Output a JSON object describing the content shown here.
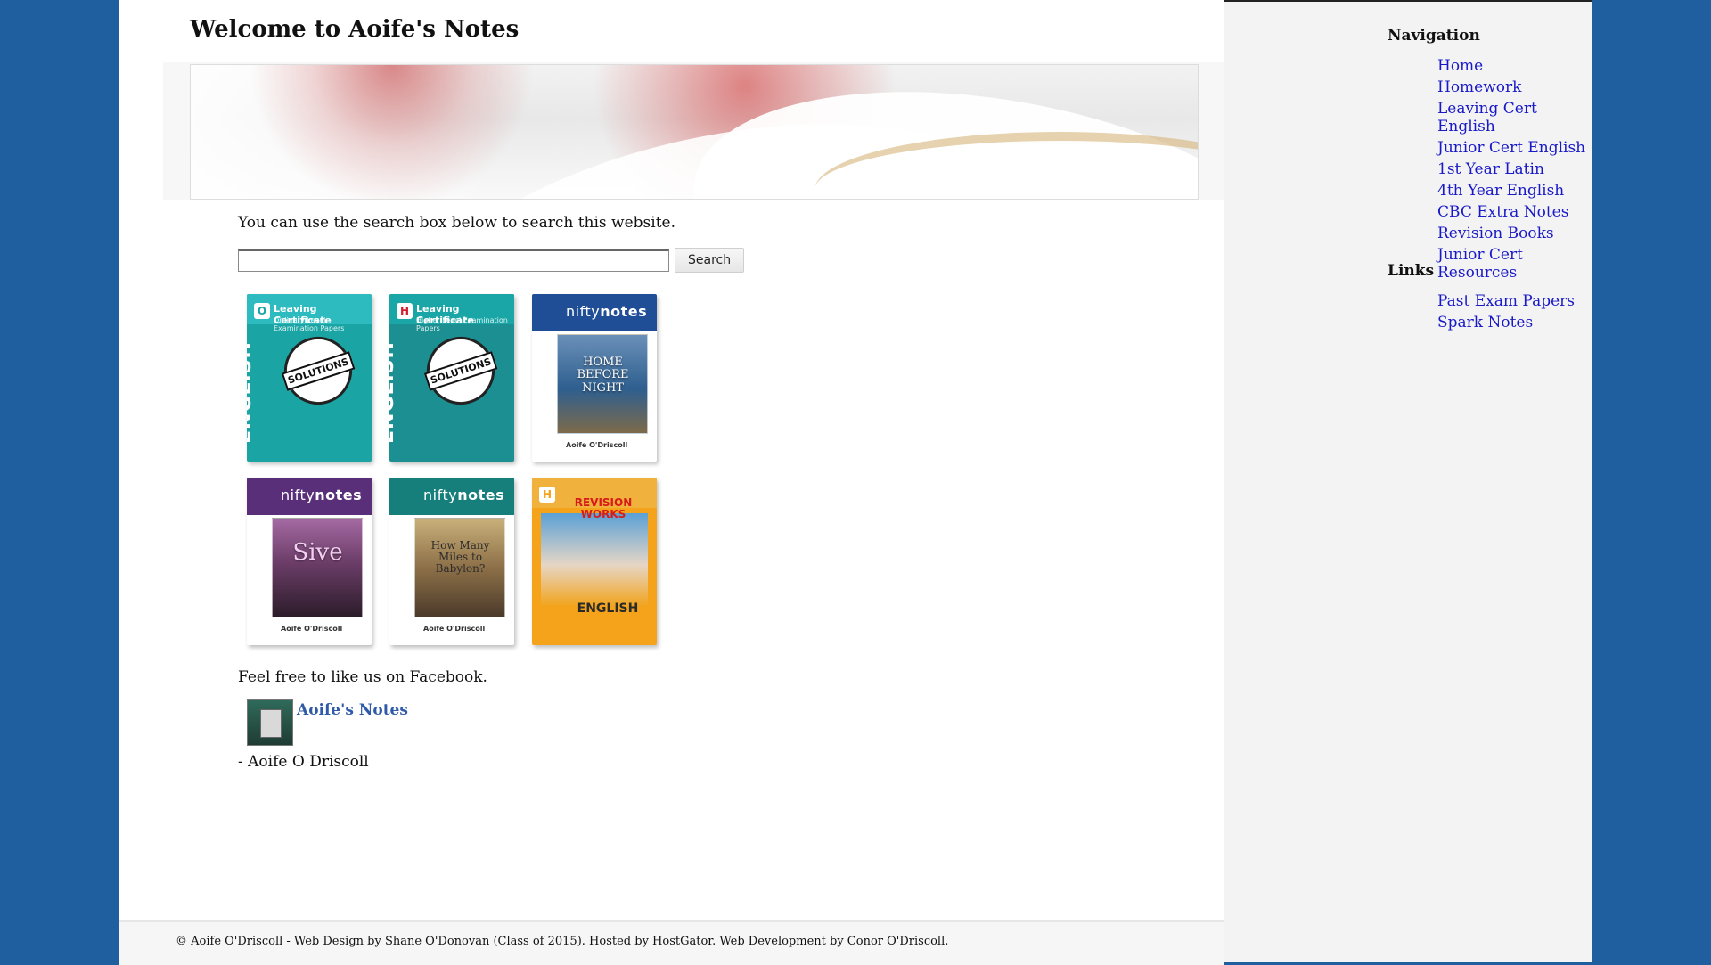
{
  "site": {
    "title": "Welcome to Aoife's Notes"
  },
  "main": {
    "intro": "You can use the search box below to search this website.",
    "search": {
      "value": "",
      "placeholder": "",
      "button_label": "Search"
    },
    "books": [
      {
        "color": "#1aa5a4",
        "level_badge": "O",
        "subject": "ENGLISH",
        "series": "Leaving Certificate",
        "subtitle": "Ordinary Level Examination Papers",
        "seal": "SOLUTIONS"
      },
      {
        "color": "#1b8f91",
        "level_badge": "H",
        "subject": "ENGLISH",
        "series": "Leaving Certificate",
        "subtitle": "Higher Level Examination Papers",
        "seal": "SOLUTIONS"
      },
      {
        "color": "#1f4e96",
        "brand": "nifty",
        "brand_bold": "notes",
        "title": "HOME BEFORE NIGHT",
        "author": "Aoife O'Driscoll"
      },
      {
        "color": "#5a2f7a",
        "brand": "nifty",
        "brand_bold": "notes",
        "title": "Sive",
        "author": "Aoife O'Driscoll"
      },
      {
        "color": "#167e7b",
        "brand": "nifty",
        "brand_bold": "notes",
        "title": "How Many Miles to Babylon?",
        "author": "Aoife O'Driscoll"
      },
      {
        "color": "#f4a31a",
        "level_badge": "H",
        "title": "REVISION WORKS",
        "subject": "ENGLISH"
      }
    ],
    "facebook_text": "Feel free to like us on Facebook.",
    "facebook_link": "Aoife's Notes",
    "signature": "- Aoife O Driscoll"
  },
  "footer": {
    "text": "© Aoife O'Driscoll - Web Design by Shane O'Donovan (Class of 2015). Hosted by HostGator. Web Development by Conor O'Driscoll."
  },
  "sidebar": {
    "navigation_title": "Navigation",
    "navigation_items": [
      "Home",
      "Homework",
      "Leaving Cert English",
      "Junior Cert English",
      "1st Year Latin",
      "4th Year English",
      "CBC Extra Notes",
      "Revision Books",
      "Junior Cert Resources"
    ],
    "links_title": "Links",
    "links_items": [
      "Past Exam Papers",
      "Spark Notes"
    ]
  },
  "colors": {
    "background": "#1f5f9f",
    "nav_link": "#1919c7",
    "facebook_link": "#2f5aa8"
  }
}
